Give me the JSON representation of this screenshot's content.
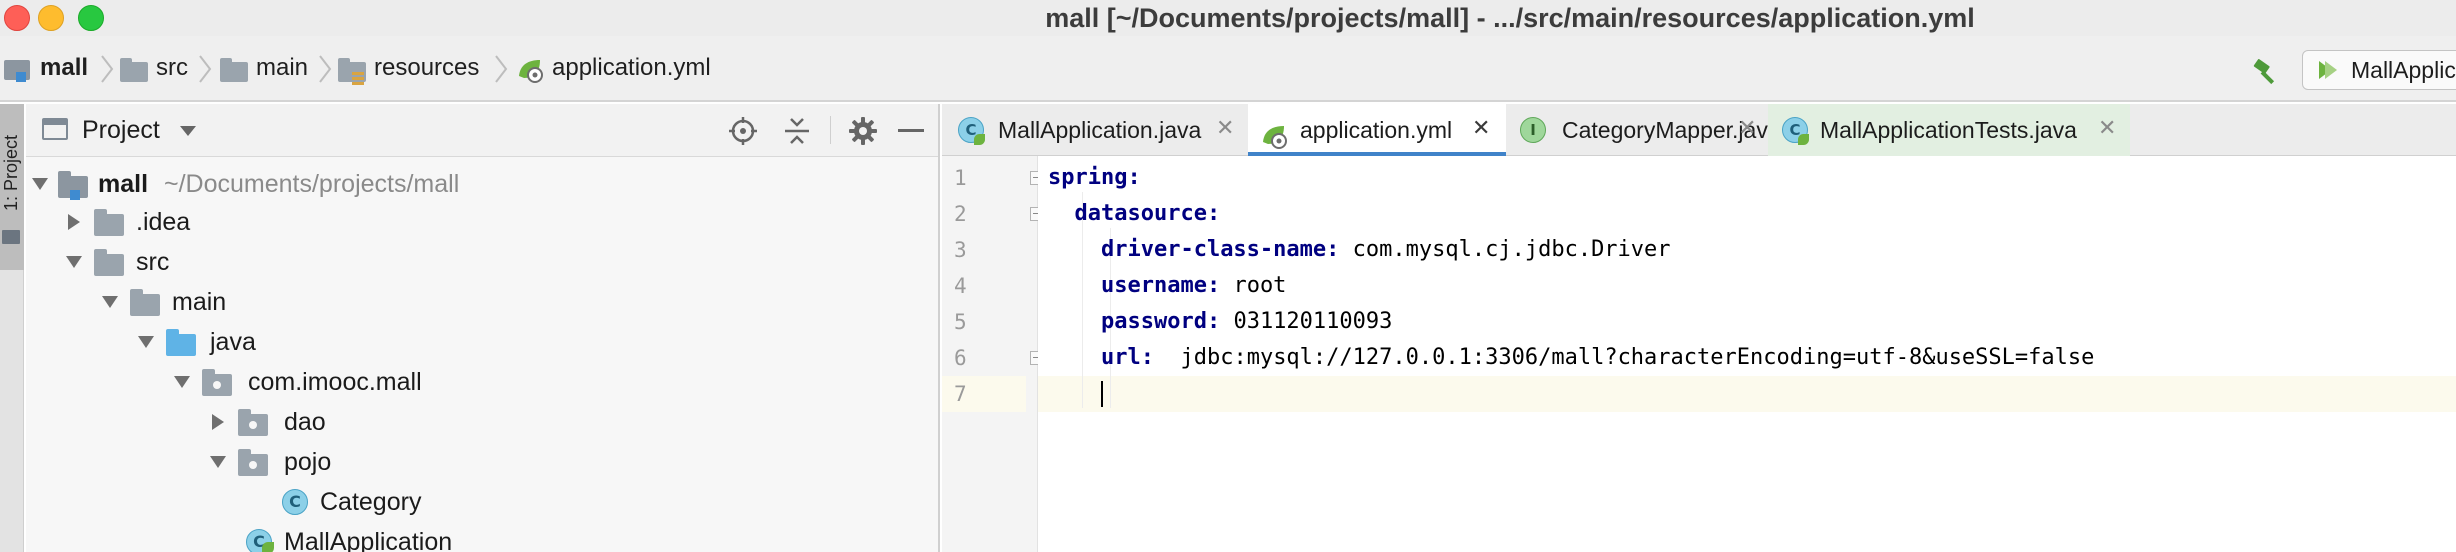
{
  "window": {
    "title": "mall [~/Documents/projects/mall] - .../src/main/resources/application.yml"
  },
  "breadcrumb": {
    "items": [
      "mall",
      "src",
      "main",
      "resources",
      "application.yml"
    ],
    "run_config": "MallApplic"
  },
  "tool_strip": {
    "label": "1: Project"
  },
  "project_panel": {
    "title": "Project",
    "tree": [
      {
        "label": "mall",
        "path_hint": "~/Documents/projects/mall"
      },
      {
        "label": ".idea"
      },
      {
        "label": "src"
      },
      {
        "label": "main"
      },
      {
        "label": "java"
      },
      {
        "label": "com.imooc.mall"
      },
      {
        "label": "dao"
      },
      {
        "label": "pojo"
      },
      {
        "label": "Category"
      },
      {
        "label": "MallApplication"
      }
    ]
  },
  "editor": {
    "tabs": [
      {
        "label": "MallApplication.java",
        "icon": "spring-class-icon"
      },
      {
        "label": "application.yml",
        "icon": "spring-config-icon",
        "active": true
      },
      {
        "label": "CategoryMapper.java",
        "icon": "interface-icon"
      },
      {
        "label": "MallApplicationTests.java",
        "icon": "spring-class-icon"
      }
    ],
    "line_numbers": [
      "1",
      "2",
      "3",
      "4",
      "5",
      "6",
      "7"
    ],
    "lines": [
      {
        "key": "spring",
        "sep": ":",
        "value": ""
      },
      {
        "key": "datasource",
        "sep": ":",
        "value": ""
      },
      {
        "key": "driver-class-name",
        "sep": ":",
        "value": " com.mysql.cj.jdbc.Driver"
      },
      {
        "key": "username",
        "sep": ":",
        "value": " root"
      },
      {
        "key": "password",
        "sep": ":",
        "value": " 031120110093"
      },
      {
        "key": "url",
        "sep": ":",
        "value": "  jdbc:mysql://127.0.0.1:3306/mall?characterEncoding=utf-8&useSSL=false"
      },
      {
        "key": "",
        "sep": "",
        "value": ""
      }
    ]
  },
  "colors": {
    "yaml_key": "#000080",
    "active_tab_underline": "#4083c9",
    "current_line": "#fcfaed",
    "spring_green": "#6db33f"
  }
}
